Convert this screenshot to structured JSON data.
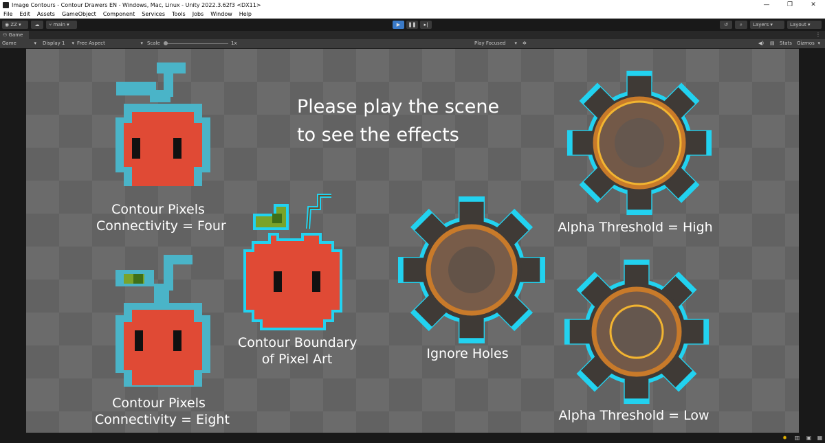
{
  "window": {
    "title": "Image Contours - Contour Drawers EN - Windows, Mac, Linux - Unity 2022.3.62f3 <DX11>",
    "minimize_glyph": "—",
    "maximize_glyph": "❐",
    "close_glyph": "✕"
  },
  "menu": [
    "File",
    "Edit",
    "Assets",
    "GameObject",
    "Component",
    "Services",
    "Tools",
    "Jobs",
    "Window",
    "Help"
  ],
  "toolbar": {
    "account": "ZZ",
    "branch": "main",
    "layers": "Layers",
    "layout": "Layout"
  },
  "panel": {
    "tab": "Game"
  },
  "gamebar": {
    "mode": "Game",
    "display": "Display 1",
    "aspect": "Free Aspect",
    "scale_label": "Scale",
    "scale_value": "1x",
    "play_focused": "Play Focused",
    "stats": "Stats",
    "gizmos": "Gizmos"
  },
  "scene": {
    "instruction_line1": "Please play the scene",
    "instruction_line2": "to see the effects",
    "labels": {
      "four_line1": "Contour Pixels",
      "four_line2": "Connectivity = Four",
      "eight_line1": "Contour Pixels",
      "eight_line2": "Connectivity = Eight",
      "boundary_line1": "Contour Boundary",
      "boundary_line2": "of Pixel Art",
      "holes": "Ignore Holes",
      "high": "Alpha Threshold = High",
      "low": "Alpha Threshold = Low"
    }
  },
  "colors": {
    "checker_light": "#6b6b6b",
    "checker_dark": "#626262",
    "apple_red": "#e04a35",
    "contour_blue": "#4ab4c8",
    "contour_cyan": "#22d2f0",
    "leaf_green": "#7aa32a",
    "gear_body": "#3f3a36",
    "ring_orange": "#c87a2a",
    "ring_yellow": "#f2b531"
  }
}
